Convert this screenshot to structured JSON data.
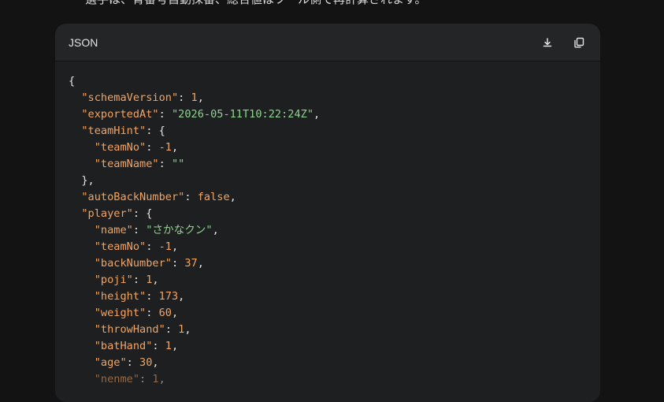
{
  "top_text": "選手は、背番号自動採番、総合値はツール側で再計算されます。",
  "code_block": {
    "language": "JSON",
    "download_icon": "download-icon",
    "copy_icon": "copy-icon",
    "lines": [
      [
        {
          "t": "p",
          "v": "{"
        }
      ],
      [
        {
          "t": "p",
          "v": "  "
        },
        {
          "t": "k",
          "v": "\"schemaVersion\""
        },
        {
          "t": "p",
          "v": ": "
        },
        {
          "t": "n",
          "v": "1"
        },
        {
          "t": "p",
          "v": ","
        }
      ],
      [
        {
          "t": "p",
          "v": "  "
        },
        {
          "t": "k",
          "v": "\"exportedAt\""
        },
        {
          "t": "p",
          "v": ": "
        },
        {
          "t": "s",
          "v": "\"2026-05-11T10:22:24Z\""
        },
        {
          "t": "p",
          "v": ","
        }
      ],
      [
        {
          "t": "p",
          "v": "  "
        },
        {
          "t": "k",
          "v": "\"teamHint\""
        },
        {
          "t": "p",
          "v": ": {"
        }
      ],
      [
        {
          "t": "p",
          "v": "    "
        },
        {
          "t": "k",
          "v": "\"teamNo\""
        },
        {
          "t": "p",
          "v": ": "
        },
        {
          "t": "n",
          "v": "-1"
        },
        {
          "t": "p",
          "v": ","
        }
      ],
      [
        {
          "t": "p",
          "v": "    "
        },
        {
          "t": "k",
          "v": "\"teamName\""
        },
        {
          "t": "p",
          "v": ": "
        },
        {
          "t": "s",
          "v": "\"\""
        }
      ],
      [
        {
          "t": "p",
          "v": "  },"
        }
      ],
      [
        {
          "t": "p",
          "v": "  "
        },
        {
          "t": "k",
          "v": "\"autoBackNumber\""
        },
        {
          "t": "p",
          "v": ": "
        },
        {
          "t": "b",
          "v": "false"
        },
        {
          "t": "p",
          "v": ","
        }
      ],
      [
        {
          "t": "p",
          "v": "  "
        },
        {
          "t": "k",
          "v": "\"player\""
        },
        {
          "t": "p",
          "v": ": {"
        }
      ],
      [
        {
          "t": "p",
          "v": "    "
        },
        {
          "t": "k",
          "v": "\"name\""
        },
        {
          "t": "p",
          "v": ": "
        },
        {
          "t": "s",
          "v": "\"さかなクン\""
        },
        {
          "t": "p",
          "v": ","
        }
      ],
      [
        {
          "t": "p",
          "v": "    "
        },
        {
          "t": "k",
          "v": "\"teamNo\""
        },
        {
          "t": "p",
          "v": ": "
        },
        {
          "t": "n",
          "v": "-1"
        },
        {
          "t": "p",
          "v": ","
        }
      ],
      [
        {
          "t": "p",
          "v": "    "
        },
        {
          "t": "k",
          "v": "\"backNumber\""
        },
        {
          "t": "p",
          "v": ": "
        },
        {
          "t": "n",
          "v": "37"
        },
        {
          "t": "p",
          "v": ","
        }
      ],
      [
        {
          "t": "p",
          "v": "    "
        },
        {
          "t": "k",
          "v": "\"poji\""
        },
        {
          "t": "p",
          "v": ": "
        },
        {
          "t": "n",
          "v": "1"
        },
        {
          "t": "p",
          "v": ","
        }
      ],
      [
        {
          "t": "p",
          "v": "    "
        },
        {
          "t": "k",
          "v": "\"height\""
        },
        {
          "t": "p",
          "v": ": "
        },
        {
          "t": "n",
          "v": "173"
        },
        {
          "t": "p",
          "v": ","
        }
      ],
      [
        {
          "t": "p",
          "v": "    "
        },
        {
          "t": "k",
          "v": "\"weight\""
        },
        {
          "t": "p",
          "v": ": "
        },
        {
          "t": "n",
          "v": "60"
        },
        {
          "t": "p",
          "v": ","
        }
      ],
      [
        {
          "t": "p",
          "v": "    "
        },
        {
          "t": "k",
          "v": "\"throwHand\""
        },
        {
          "t": "p",
          "v": ": "
        },
        {
          "t": "n",
          "v": "1"
        },
        {
          "t": "p",
          "v": ","
        }
      ],
      [
        {
          "t": "p",
          "v": "    "
        },
        {
          "t": "k",
          "v": "\"batHand\""
        },
        {
          "t": "p",
          "v": ": "
        },
        {
          "t": "n",
          "v": "1"
        },
        {
          "t": "p",
          "v": ","
        }
      ],
      [
        {
          "t": "p",
          "v": "    "
        },
        {
          "t": "k",
          "v": "\"age\""
        },
        {
          "t": "p",
          "v": ": "
        },
        {
          "t": "n",
          "v": "30"
        },
        {
          "t": "p",
          "v": ","
        }
      ],
      [
        {
          "t": "p",
          "v": "    "
        },
        {
          "t": "k",
          "v": "\"nenme\""
        },
        {
          "t": "p",
          "v": ": "
        },
        {
          "t": "n",
          "v": "1"
        },
        {
          "t": "p",
          "v": ","
        }
      ]
    ]
  },
  "colors": {
    "background": "#131313",
    "card": "#1e1f20",
    "header": "#242526",
    "key": "#f5a45e",
    "string": "#8fd18f",
    "number": "#f5a45e",
    "punct": "#e3e3e3"
  }
}
